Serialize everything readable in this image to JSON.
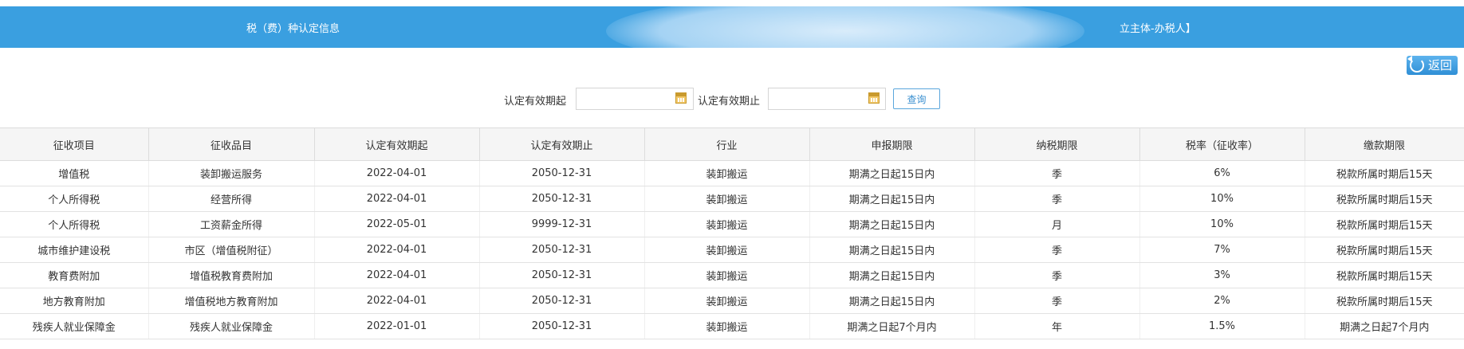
{
  "header": {
    "title": "税（费）种认定信息",
    "right_text": "立主体-办税人】"
  },
  "back_button": {
    "label": "返回"
  },
  "filter": {
    "start_label": "认定有效期起",
    "end_label": "认定有效期止",
    "start_value": "",
    "end_value": "",
    "query_label": "查询"
  },
  "table": {
    "columns": [
      "征收项目",
      "征收品目",
      "认定有效期起",
      "认定有效期止",
      "行业",
      "申报期限",
      "纳税期限",
      "税率（征收率）",
      "缴款期限"
    ],
    "rows": [
      [
        "增值税",
        "装卸搬运服务",
        "2022-04-01",
        "2050-12-31",
        "装卸搬运",
        "期满之日起15日内",
        "季",
        "6%",
        "税款所属时期后15天"
      ],
      [
        "个人所得税",
        "经营所得",
        "2022-04-01",
        "2050-12-31",
        "装卸搬运",
        "期满之日起15日内",
        "季",
        "10%",
        "税款所属时期后15天"
      ],
      [
        "个人所得税",
        "工资薪金所得",
        "2022-05-01",
        "9999-12-31",
        "装卸搬运",
        "期满之日起15日内",
        "月",
        "10%",
        "税款所属时期后15天"
      ],
      [
        "城市维护建设税",
        "市区（增值税附征）",
        "2022-04-01",
        "2050-12-31",
        "装卸搬运",
        "期满之日起15日内",
        "季",
        "7%",
        "税款所属时期后15天"
      ],
      [
        "教育费附加",
        "增值税教育费附加",
        "2022-04-01",
        "2050-12-31",
        "装卸搬运",
        "期满之日起15日内",
        "季",
        "3%",
        "税款所属时期后15天"
      ],
      [
        "地方教育附加",
        "增值税地方教育附加",
        "2022-04-01",
        "2050-12-31",
        "装卸搬运",
        "期满之日起15日内",
        "季",
        "2%",
        "税款所属时期后15天"
      ],
      [
        "残疾人就业保障金",
        "残疾人就业保障金",
        "2022-01-01",
        "2050-12-31",
        "装卸搬运",
        "期满之日起7个月内",
        "年",
        "1.5%",
        "期满之日起7个月内"
      ]
    ]
  },
  "colors": {
    "header_bg": "#3a9fe0",
    "accent": "#3a8fd0",
    "calendar_icon": "#f3c96a"
  }
}
